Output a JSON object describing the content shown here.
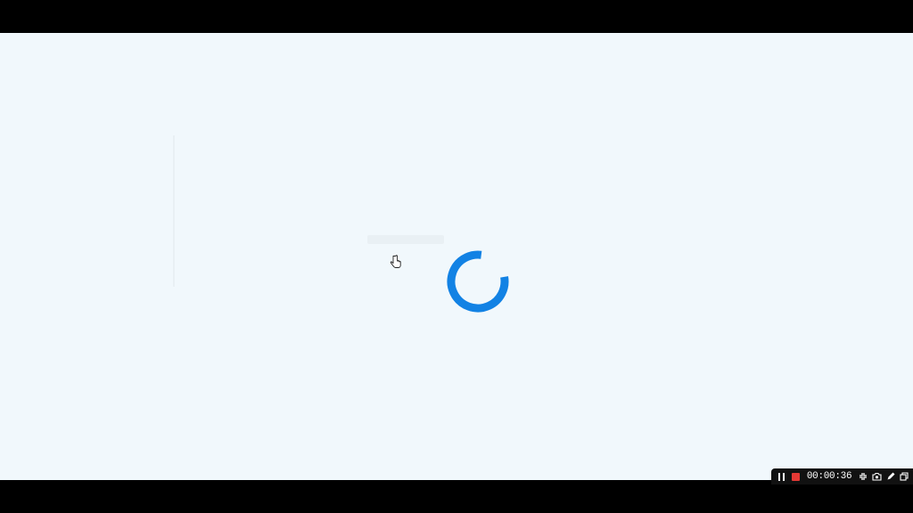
{
  "screen": {
    "background": "#f1f8fc",
    "letterbox_color": "#000000"
  },
  "loading": {
    "state": "loading",
    "spinner_icon": "loading-spinner-icon",
    "spinner_color": "#1282e4"
  },
  "cursor": {
    "icon": "hand-pointer-icon"
  },
  "recorder": {
    "timer": "00:00:36",
    "pause_icon": "pause-icon",
    "stop_icon": "stop-icon",
    "stop_color": "#e53935",
    "minimize_icon": "collapse-icon",
    "camera_icon": "camera-icon",
    "draw_icon": "pen-icon",
    "window_icon": "window-icon"
  }
}
